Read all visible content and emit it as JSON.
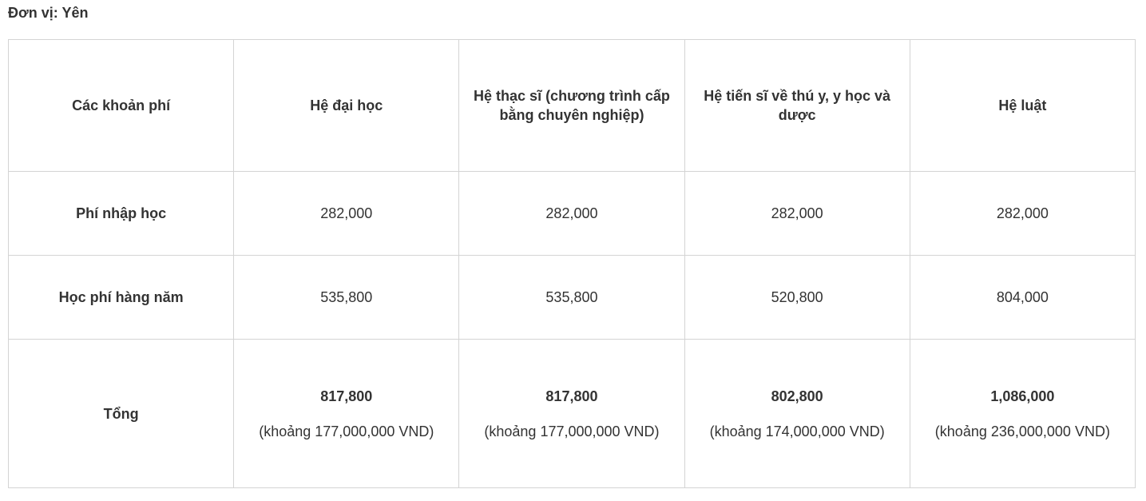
{
  "unit_label": "Đơn vị: Yên",
  "table": {
    "headers": [
      "Các khoản phí",
      "Hệ đại học",
      "Hệ thạc sĩ (chương trình cấp bằng chuyên nghiệp)",
      "Hệ tiến sĩ về thú y, y học và dược",
      "Hệ luật"
    ],
    "rows": [
      {
        "label": "Phí nhập học",
        "values": [
          "282,000",
          "282,000",
          "282,000",
          "282,000"
        ]
      },
      {
        "label": "Học phí hàng năm",
        "values": [
          "535,800",
          "535,800",
          "520,800",
          "804,000"
        ]
      }
    ],
    "total": {
      "label": "Tổng",
      "values": [
        "817,800",
        "817,800",
        "802,800",
        "1,086,000"
      ],
      "approx": [
        "(khoảng 177,000,000 VND)",
        "(khoảng 177,000,000 VND)",
        "(khoảng 174,000,000 VND)",
        "(khoảng 236,000,000 VND)"
      ]
    }
  }
}
